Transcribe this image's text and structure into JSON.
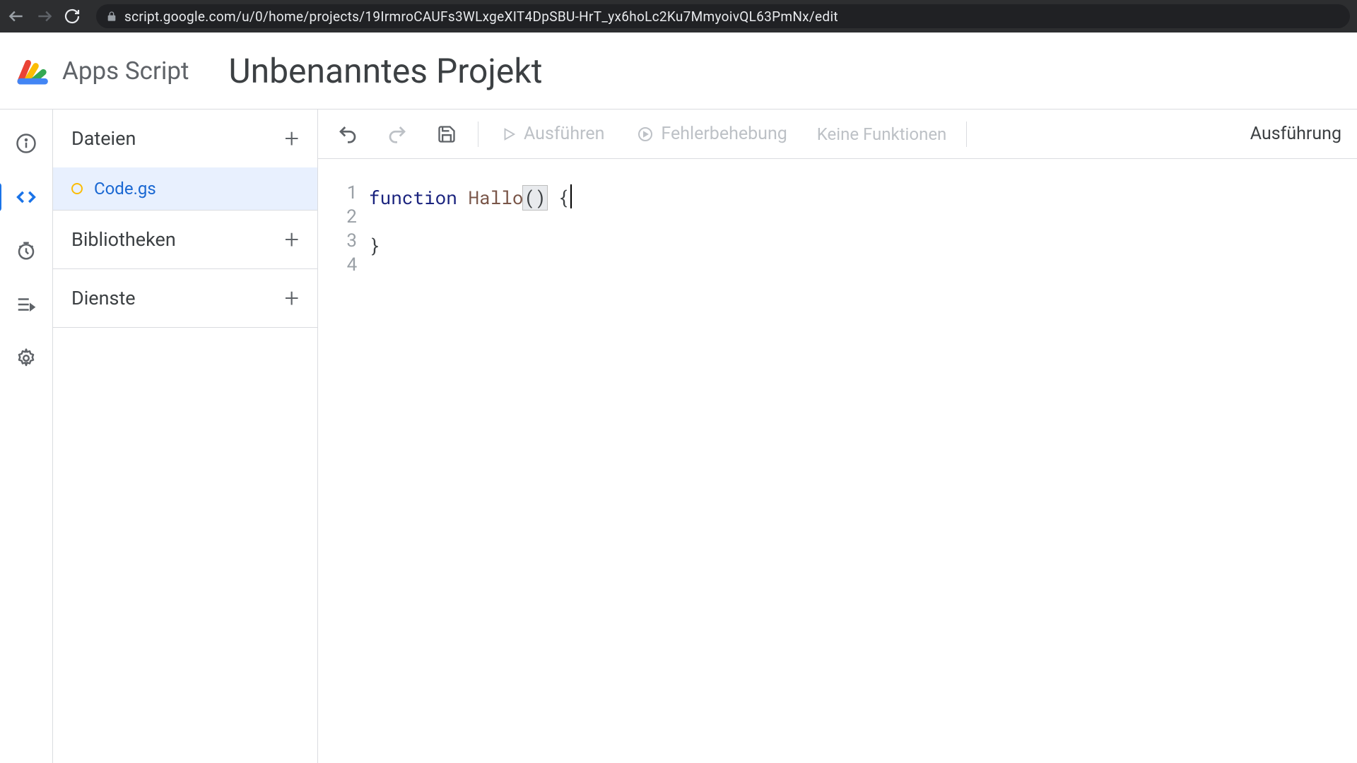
{
  "browser": {
    "url": "script.google.com/u/0/home/projects/19IrmroCAUFs3WLxgeXIT4DpSBU-HrT_yx6hoLc2Ku7MmyoivQL63PmNx/edit"
  },
  "header": {
    "app_title": "Apps Script",
    "project_name": "Unbenanntes Projekt"
  },
  "sidebar": {
    "files_label": "Dateien",
    "libraries_label": "Bibliotheken",
    "services_label": "Dienste",
    "file_name": "Code.gs"
  },
  "toolbar": {
    "run_label": "Ausführen",
    "debug_label": "Fehlerbehebung",
    "func_select": "Keine Funktionen",
    "exec_log": "Ausführung"
  },
  "code": {
    "lines": [
      "1",
      "2",
      "3",
      "4"
    ],
    "keyword": "function",
    "func_name": "Hallo",
    "parens": "()",
    "brace_open": "{",
    "brace_close": "}"
  }
}
